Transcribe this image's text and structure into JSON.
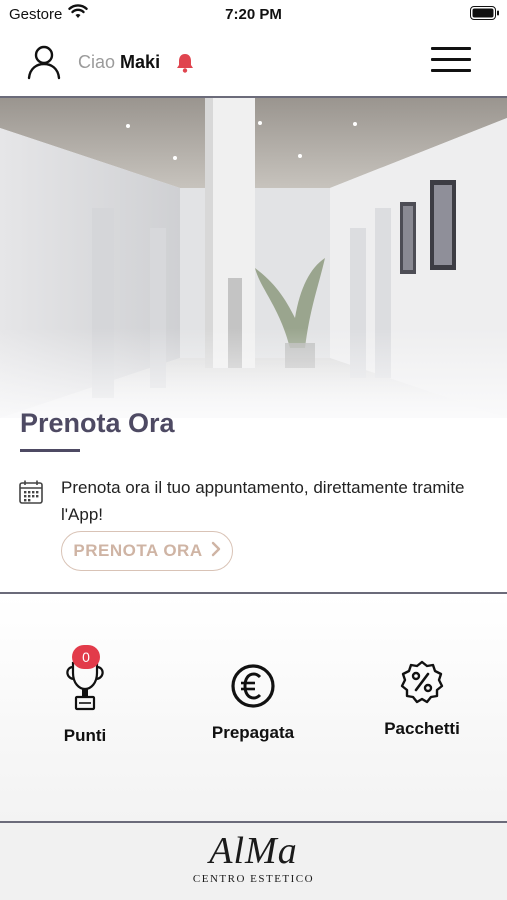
{
  "status_bar": {
    "carrier": "Gestore",
    "time": "7:20 PM"
  },
  "header": {
    "greeting": "Ciao",
    "user_name": "Maki"
  },
  "booking_card": {
    "title": "Prenota Ora",
    "description": "Prenota ora il tuo appuntamento, direttamente tramite l'App!",
    "cta_label": "PRENOTA ORA"
  },
  "features": [
    {
      "label": "Punti",
      "icon": "trophy-icon",
      "badge": "0"
    },
    {
      "label": "Prepagata",
      "icon": "euro-coin-icon"
    },
    {
      "label": "Pacchetti",
      "icon": "discount-badge-icon"
    }
  ],
  "footer": {
    "logo_main": "AlMa",
    "logo_sub": "CENTRO ESTETICO"
  },
  "colors": {
    "accent": "#4e4a63",
    "cta": "#cfb4a4",
    "badge": "#e23b4a",
    "bell": "#e0454f"
  }
}
